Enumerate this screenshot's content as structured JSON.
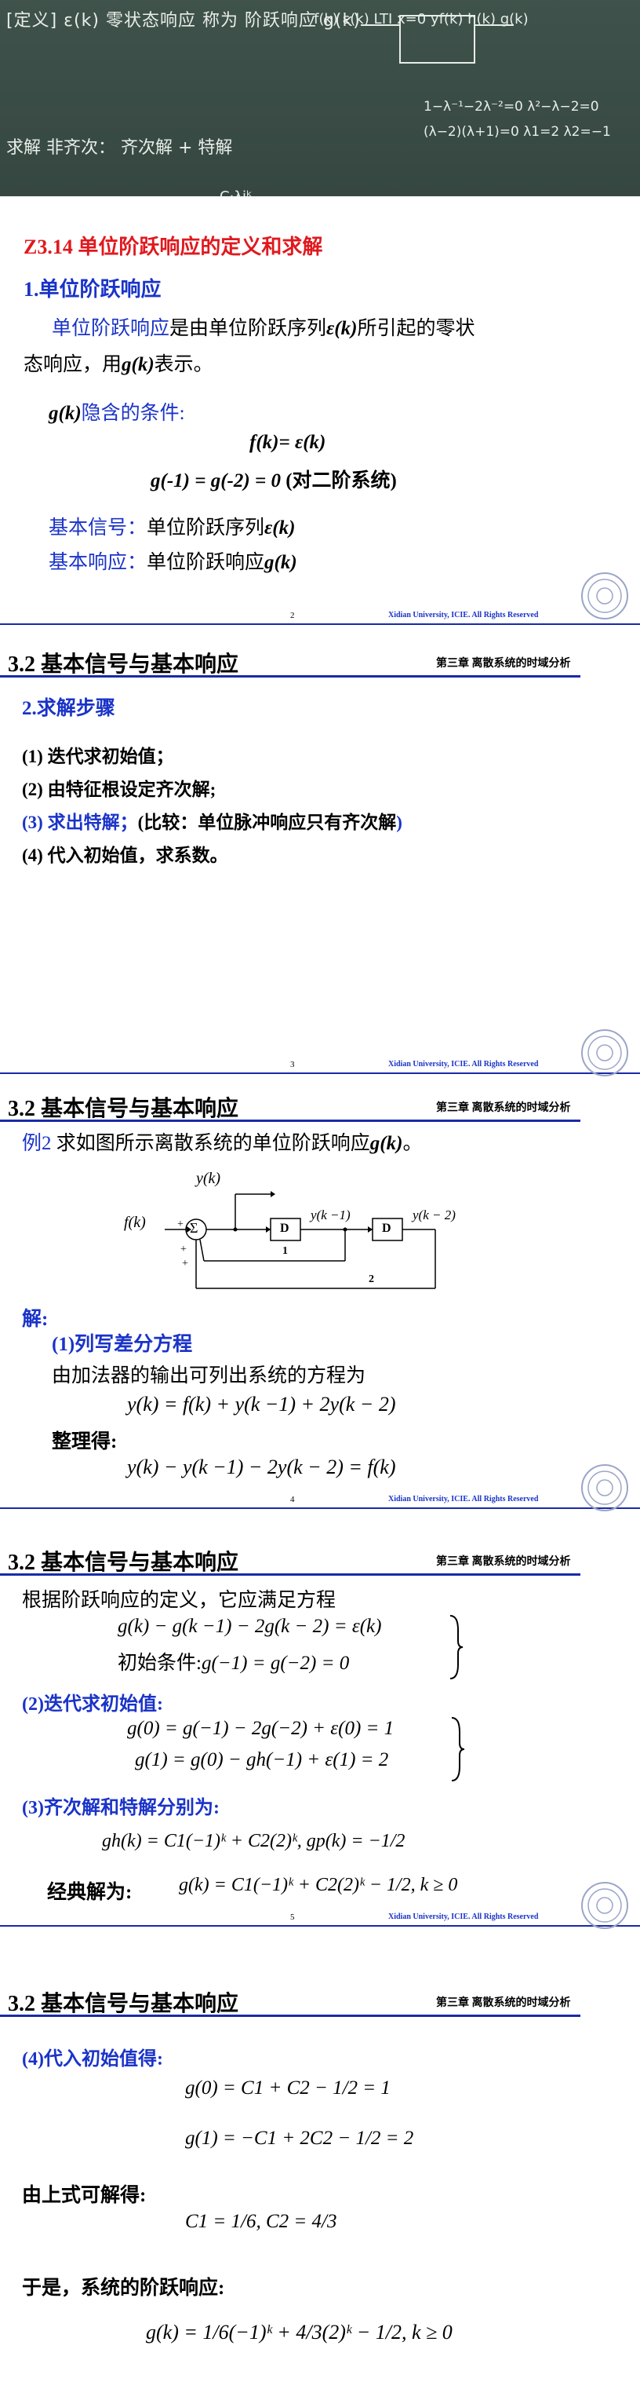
{
  "blackboard": {
    "row1": "[定义] ε(k) 零状态响应 称为 阶跃响应 g(k)",
    "row1_right": "f(k) ε(k)   LTI x=0   yf(k) h(k) g(k)",
    "row2": "求解 非齐次： 齐次解 + 特解",
    "row2_right": "1−λ⁻¹−2λ⁻²=0  λ²−λ−2=0  (λ−2)(λ+1)=0  λ1=2 λ2=−1",
    "row2_note": "C·λiᵏ"
  },
  "slide2": {
    "heading": "Z3.14 单位阶跃响应的定义和求解",
    "sub1": "1.单位阶跃响应",
    "para_a": "单位阶跃响应",
    "para_b": "是由单位阶跃序列",
    "para_c": "ε(k)",
    "para_d": "所引起的零状",
    "para_e": "态响应，用",
    "para_f": "g(k)",
    "para_g": "表示。",
    "cond_label_a": "g(k)",
    "cond_label_b": "隐含的条件:",
    "cond_eq1": "f(k)= ε(k)",
    "cond_eq2": "g(-1) = g(-2) = 0",
    "cond_eq2_note": "(对二阶系统)",
    "basic_signal_label": "基本信号：",
    "basic_signal_text": "单位阶跃序列",
    "basic_signal_sym": "ε(k)",
    "basic_response_label": "基本响应：",
    "basic_response_text": "单位阶跃响应",
    "basic_response_sym": "g(k)",
    "page_num": "2",
    "footer": "Xidian University, ICIE. All Rights Reserved"
  },
  "slide3": {
    "header_title": "3.2  基本信号与基本响应",
    "header_chapter": "第三章 离散系统的时域分析",
    "sub2": "2.求解步骤",
    "step1": "(1) 迭代求初始值；",
    "step2": "(2) 由特征根设定齐次解;",
    "step3_a": "(3) 求出特解；",
    "step3_b": "(比较：单位脉冲响应只有齐次解",
    "step3_c": ")",
    "step4": "(4) 代入初始值，求系数。",
    "page_num": "3",
    "footer": "Xidian University, ICIE. All Rights Reserved"
  },
  "slide4": {
    "header_title": "3.2  基本信号与基本响应",
    "header_chapter": "第三章 离散系统的时域分析",
    "example_a": "例2",
    "example_b": "求如图所示离散系统的单位阶跃响应",
    "example_c": "g(k)",
    "example_d": "。",
    "diag": {
      "yk": "y(k)",
      "fk": "f(k)",
      "plus1": "+",
      "plus2": "+",
      "plus3": "+",
      "sigma": "Σ",
      "d1": "D",
      "d2": "D",
      "yk1": "y(k −1)",
      "yk2": "y(k − 2)",
      "g1": "1",
      "g2": "2"
    },
    "sol": "解:",
    "s1": "(1)列写差分方程",
    "s1_text": "由加法器的输出可列出系统的方程为",
    "eq1": "y(k) = f(k) + y(k −1) + 2y(k − 2)",
    "arrange": "整理得:",
    "eq2": "y(k) − y(k −1) − 2y(k − 2) = f(k)",
    "page_num": "4",
    "footer": "Xidian University, ICIE. All Rights Reserved"
  },
  "slide5": {
    "header_title": "3.2  基本信号与基本响应",
    "header_chapter": "第三章 离散系统的时域分析",
    "intro": "根据阶跃响应的定义，它应满足方程",
    "eqA": "g(k) − g(k −1) − 2g(k − 2) = ε(k)",
    "eqB_label": "初始条件:",
    "eqB": "g(−1) = g(−2) = 0",
    "s2": "(2)迭代求初始值:",
    "eqC": "g(0) = g(−1) − 2g(−2) + ε(0) = 1",
    "eqD": "g(1) = g(0) − gh(−1) + ε(1) = 2",
    "s3": "(3)齐次解和特解分别为:",
    "eqE": "gh(k) = C1(−1)ᵏ + C2(2)ᵏ,  gp(k) = −1/2",
    "classic_label": "经典解为:",
    "eqF": "g(k) = C1(−1)ᵏ + C2(2)ᵏ − 1/2,  k ≥ 0",
    "page_num": "5",
    "footer": "Xidian University, ICIE. All Rights Reserved"
  },
  "slide6": {
    "header_title": "3.2  基本信号与基本响应",
    "header_chapter": "第三章 离散系统的时域分析",
    "s4": "(4)代入初始值得:",
    "eqG": "g(0) = C1 + C2 − 1/2 = 1",
    "eqH": "g(1) = −C1 + 2C2 − 1/2 = 2",
    "solve_label": "由上式可解得:",
    "eqI": "C1 = 1/6, C2 = 4/3",
    "result_label": "于是，系统的阶跃响应:",
    "eqJ": "g(k) = 1/6(−1)ᵏ + 4/3(2)ᵏ − 1/2,  k ≥ 0"
  },
  "colors": {
    "blue": "#1a33c8",
    "red": "#e0191e",
    "header_rule": "#1a2aa8",
    "chalkboard": "#3a4b45"
  }
}
